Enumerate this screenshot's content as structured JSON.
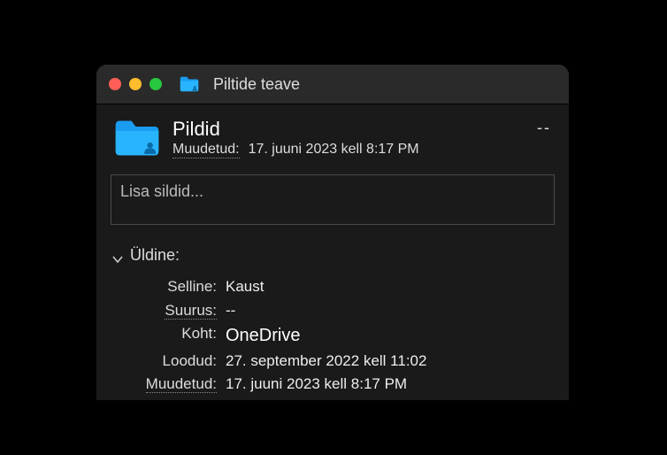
{
  "window": {
    "title": "Piltide teave"
  },
  "header": {
    "name": "Pildid",
    "modified_label": "Muudetud:",
    "modified_value": "17. juuni 2023 kell 8:17 PM",
    "size_summary": "--"
  },
  "tags": {
    "placeholder": "Lisa sildid..."
  },
  "general": {
    "title": "Üldine:",
    "rows": {
      "kind_label": "Selline:",
      "kind_value": "Kaust",
      "size_label": "Suurus:",
      "size_value": "--",
      "where_label": "Koht:",
      "where_value": "OneDrive",
      "created_label": "Loodud:",
      "created_value": "27. september 2022 kell 11:02",
      "modified_label": "Muudetud:",
      "modified_value": "17. juuni 2023 kell 8:17 PM"
    }
  }
}
